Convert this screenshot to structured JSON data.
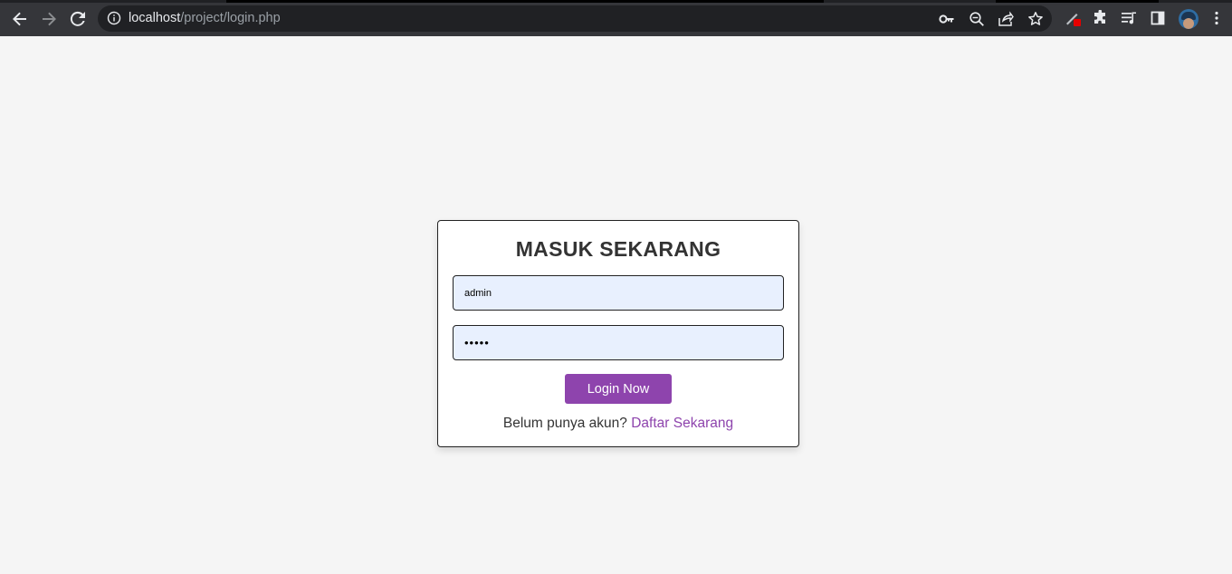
{
  "browser": {
    "url_host": "localhost",
    "url_path": "/project/login.php",
    "icons": {
      "back": "arrow-left",
      "forward": "arrow-right",
      "reload": "refresh",
      "site_info": "info-circle",
      "password": "key",
      "zoom": "magnifier-minus",
      "share": "share",
      "bookmark": "star",
      "extension_pen": "pen",
      "extensions": "puzzle",
      "reading_list": "playlist",
      "side_panel": "side-panel",
      "profile": "avatar",
      "menu": "kebab"
    },
    "colors": {
      "toolbar": "#35363a",
      "omnibox": "#202124",
      "icon": "#e8eaed"
    }
  },
  "login": {
    "title": "MASUK SEKARANG",
    "username_value": "admin",
    "password_value": "admin",
    "button_label": "Login Now",
    "signup_prompt": "Belum punya akun?",
    "signup_link": "Daftar Sekarang"
  },
  "colors": {
    "accent": "#8e44ad",
    "page_bg": "#f5f5f5",
    "input_bg": "#e8f0fe",
    "title": "#333333"
  }
}
